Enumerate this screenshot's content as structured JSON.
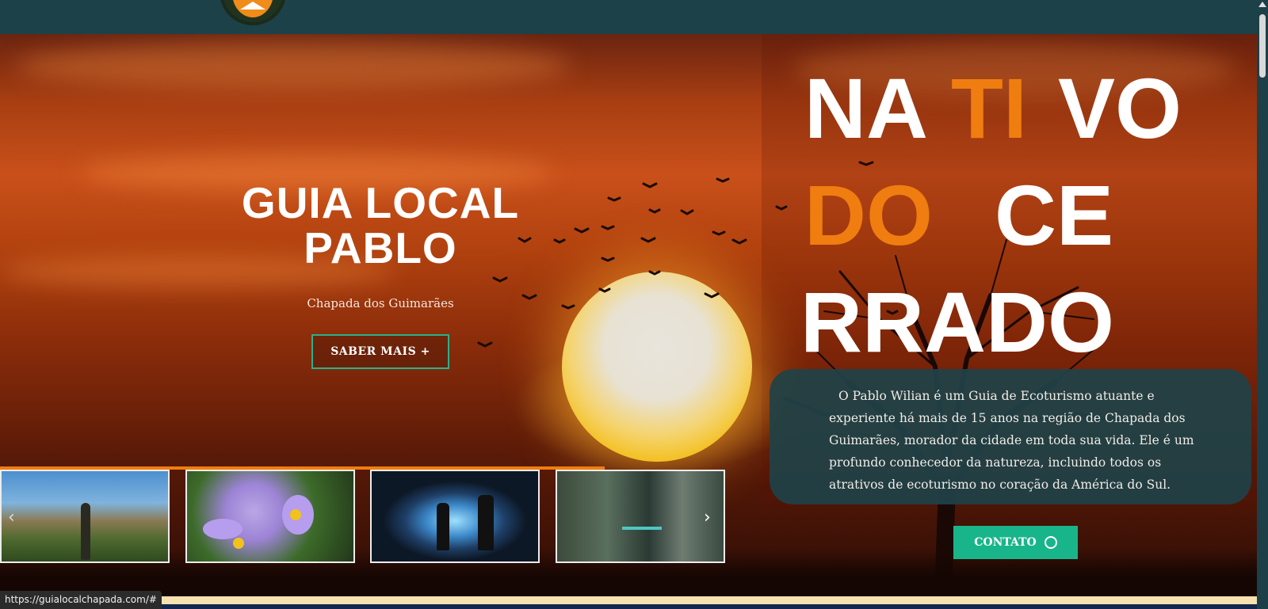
{
  "header": {
    "logo": "mountain-sun-logo"
  },
  "hero": {
    "title_line1": "GUIA LOCAL",
    "title_line2": "PABLO",
    "subtitle": "Chapada dos Guimarães",
    "cta": "SABER MAIS +"
  },
  "headline": {
    "w1": "NA",
    "w2": "TI",
    "w3": "VO",
    "w4": "DO",
    "w5": "CE",
    "w6": "RRADO"
  },
  "about": {
    "text": "O Pablo Wilian é um Guia de Ecoturismo atuante e experiente há mais de 15 anos na região de Chapada dos Guimarães, morador da cidade em toda sua vida. Ele é um profundo conhecedor da natureza, incluindo todos os atrativos de ecoturismo no coração da América do Sul."
  },
  "contact": {
    "label": "CONTATO",
    "icon": "whatsapp-icon"
  },
  "carousel": {
    "prev": "‹",
    "next": "›",
    "items": [
      "mountain-photo",
      "flowers-photo",
      "cave-photo",
      "canyon-photo"
    ]
  },
  "status_bar": {
    "url": "https://guialocalchapada.com/#"
  },
  "colors": {
    "accent": "#f07d0f",
    "teal": "#19b58a",
    "header": "#1c4149"
  }
}
